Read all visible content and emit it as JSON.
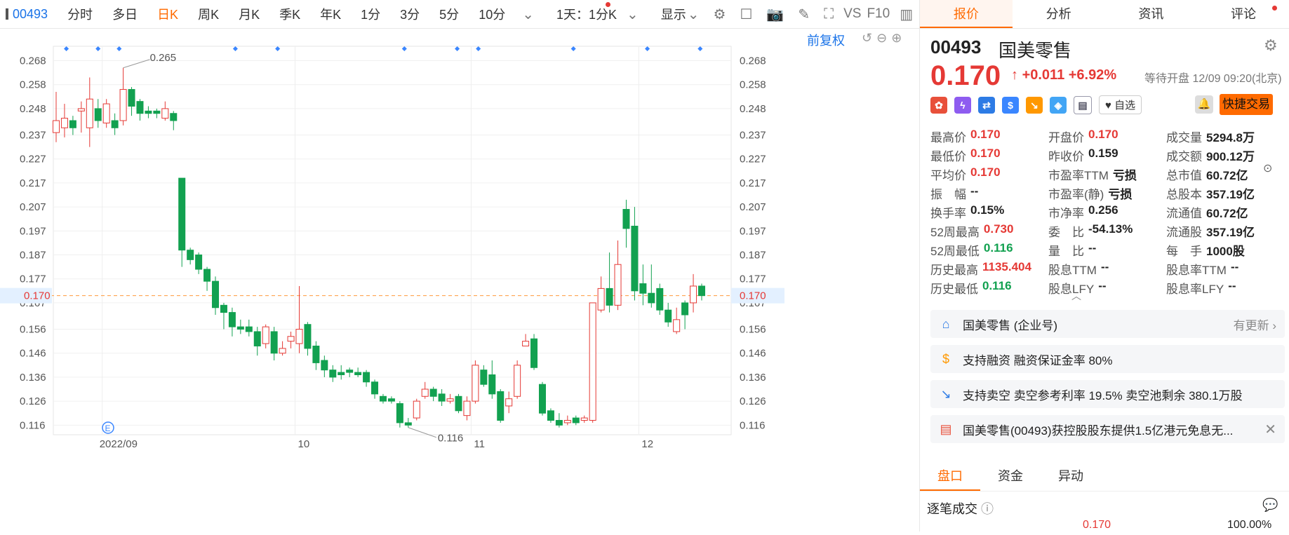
{
  "toolbar": {
    "code": "00493",
    "items": [
      "分时",
      "多日",
      "日K",
      "周K",
      "月K",
      "季K",
      "年K",
      "1分",
      "3分",
      "5分",
      "10分"
    ],
    "active": "日K",
    "period_select": "1天：1分K",
    "display": "显示",
    "vs": "VS",
    "f10": "F10"
  },
  "chart": {
    "fuquan_label": "前复权",
    "y_ticks": [
      "0.268",
      "0.258",
      "0.248",
      "0.237",
      "0.227",
      "0.217",
      "0.207",
      "0.197",
      "0.187",
      "0.177",
      "0.167",
      "0.156",
      "0.146",
      "0.136",
      "0.126",
      "0.116"
    ],
    "x_labels": [
      "2022/09",
      "10",
      "11",
      "12"
    ],
    "current_price_label": "0.170",
    "max_label": "0.265",
    "min_label": "0.116",
    "event_marker": "E"
  },
  "chart_data": {
    "type": "candlestick",
    "ylim": [
      0.112,
      0.274
    ],
    "current": 0.17,
    "candles": [
      [
        0.238,
        0.243,
        0.255,
        0.234
      ],
      [
        0.24,
        0.244,
        0.25,
        0.236
      ],
      [
        0.243,
        0.24,
        0.245,
        0.237
      ],
      [
        0.247,
        0.248,
        0.251,
        0.238
      ],
      [
        0.24,
        0.252,
        0.261,
        0.232
      ],
      [
        0.248,
        0.243,
        0.252,
        0.24
      ],
      [
        0.242,
        0.25,
        0.252,
        0.24
      ],
      [
        0.243,
        0.24,
        0.246,
        0.237
      ],
      [
        0.243,
        0.256,
        0.265,
        0.241
      ],
      [
        0.256,
        0.249,
        0.257,
        0.245
      ],
      [
        0.251,
        0.246,
        0.252,
        0.243
      ],
      [
        0.247,
        0.246,
        0.249,
        0.244
      ],
      [
        0.247,
        0.246,
        0.248,
        0.244
      ],
      [
        0.244,
        0.248,
        0.251,
        0.243
      ],
      [
        0.246,
        0.243,
        0.247,
        0.239
      ],
      [
        0.219,
        0.189,
        0.219,
        0.182
      ],
      [
        0.189,
        0.185,
        0.19,
        0.183
      ],
      [
        0.187,
        0.181,
        0.188,
        0.179
      ],
      [
        0.181,
        0.176,
        0.182,
        0.172
      ],
      [
        0.176,
        0.165,
        0.178,
        0.162
      ],
      [
        0.166,
        0.163,
        0.167,
        0.156
      ],
      [
        0.163,
        0.157,
        0.165,
        0.153
      ],
      [
        0.157,
        0.156,
        0.16,
        0.154
      ],
      [
        0.157,
        0.155,
        0.16,
        0.153
      ],
      [
        0.155,
        0.149,
        0.157,
        0.145
      ],
      [
        0.15,
        0.157,
        0.158,
        0.148
      ],
      [
        0.155,
        0.146,
        0.157,
        0.143
      ],
      [
        0.146,
        0.148,
        0.151,
        0.145
      ],
      [
        0.151,
        0.153,
        0.155,
        0.148
      ],
      [
        0.15,
        0.156,
        0.174,
        0.146
      ],
      [
        0.158,
        0.148,
        0.159,
        0.145
      ],
      [
        0.149,
        0.142,
        0.151,
        0.139
      ],
      [
        0.143,
        0.139,
        0.145,
        0.136
      ],
      [
        0.139,
        0.136,
        0.141,
        0.134
      ],
      [
        0.138,
        0.137,
        0.141,
        0.135
      ],
      [
        0.139,
        0.138,
        0.14,
        0.136
      ],
      [
        0.138,
        0.137,
        0.14,
        0.136
      ],
      [
        0.138,
        0.134,
        0.139,
        0.132
      ],
      [
        0.134,
        0.129,
        0.135,
        0.127
      ],
      [
        0.128,
        0.126,
        0.129,
        0.125
      ],
      [
        0.127,
        0.126,
        0.128,
        0.125
      ],
      [
        0.125,
        0.117,
        0.126,
        0.115
      ],
      [
        0.117,
        0.116,
        0.119,
        0.115
      ],
      [
        0.119,
        0.126,
        0.127,
        0.118
      ],
      [
        0.128,
        0.131,
        0.134,
        0.127
      ],
      [
        0.131,
        0.128,
        0.132,
        0.126
      ],
      [
        0.129,
        0.126,
        0.131,
        0.124
      ],
      [
        0.126,
        0.127,
        0.129,
        0.125
      ],
      [
        0.128,
        0.122,
        0.129,
        0.121
      ],
      [
        0.12,
        0.126,
        0.128,
        0.118
      ],
      [
        0.126,
        0.141,
        0.143,
        0.125
      ],
      [
        0.139,
        0.133,
        0.141,
        0.132
      ],
      [
        0.137,
        0.129,
        0.143,
        0.127
      ],
      [
        0.13,
        0.118,
        0.131,
        0.117
      ],
      [
        0.124,
        0.127,
        0.13,
        0.121
      ],
      [
        0.128,
        0.141,
        0.143,
        0.127
      ],
      [
        0.149,
        0.151,
        0.154,
        0.149
      ],
      [
        0.152,
        0.14,
        0.154,
        0.139
      ],
      [
        0.133,
        0.121,
        0.134,
        0.12
      ],
      [
        0.122,
        0.118,
        0.123,
        0.117
      ],
      [
        0.118,
        0.116,
        0.121,
        0.115
      ],
      [
        0.117,
        0.118,
        0.12,
        0.116
      ],
      [
        0.119,
        0.117,
        0.12,
        0.116
      ],
      [
        0.118,
        0.119,
        0.12,
        0.117
      ],
      [
        0.118,
        0.167,
        0.167,
        0.117
      ],
      [
        0.164,
        0.173,
        0.178,
        0.163
      ],
      [
        0.173,
        0.166,
        0.188,
        0.163
      ],
      [
        0.166,
        0.183,
        0.193,
        0.164
      ],
      [
        0.206,
        0.198,
        0.21,
        0.19
      ],
      [
        0.199,
        0.172,
        0.207,
        0.168
      ],
      [
        0.175,
        0.171,
        0.183,
        0.166
      ],
      [
        0.171,
        0.167,
        0.183,
        0.165
      ],
      [
        0.173,
        0.164,
        0.175,
        0.162
      ],
      [
        0.164,
        0.159,
        0.167,
        0.157
      ],
      [
        0.155,
        0.16,
        0.165,
        0.154
      ],
      [
        0.167,
        0.162,
        0.168,
        0.156
      ],
      [
        0.167,
        0.174,
        0.179,
        0.163
      ],
      [
        0.174,
        0.17,
        0.175,
        0.168
      ]
    ]
  },
  "panel": {
    "tabs": [
      "报价",
      "分析",
      "资讯",
      "评论"
    ],
    "active_tab": "报价",
    "code": "00493",
    "name": "国美零售",
    "price": "0.170",
    "change": "+0.011",
    "change_pct": "+6.92%",
    "status": "等待开盘 12/09 09:20(北京)",
    "fav": "自选",
    "quick_trade": "快捷交易",
    "stats": [
      [
        [
          "最高价",
          "0.170",
          "red"
        ],
        [
          "开盘价",
          "0.170",
          "red"
        ],
        [
          "成交量",
          "5294.8万",
          ""
        ]
      ],
      [
        [
          "最低价",
          "0.170",
          "red"
        ],
        [
          "昨收价",
          "0.159",
          ""
        ],
        [
          "成交额",
          "900.12万",
          ""
        ]
      ],
      [
        [
          "平均价",
          "0.170",
          "red"
        ],
        [
          "市盈率TTM",
          "亏损",
          ""
        ],
        [
          "总市值",
          "60.72亿",
          ""
        ]
      ],
      [
        [
          "振　幅",
          "--",
          ""
        ],
        [
          "市盈率(静)",
          "亏损",
          ""
        ],
        [
          "总股本",
          "357.19亿",
          ""
        ]
      ],
      [
        [
          "换手率",
          "0.15%",
          ""
        ],
        [
          "市净率",
          "0.256",
          ""
        ],
        [
          "流通值",
          "60.72亿",
          ""
        ]
      ],
      [
        [
          "52周最高",
          "0.730",
          "red"
        ],
        [
          "委　比",
          "-54.13%",
          ""
        ],
        [
          "流通股",
          "357.19亿",
          ""
        ]
      ],
      [
        [
          "52周最低",
          "0.116",
          "green"
        ],
        [
          "量　比",
          "--",
          ""
        ],
        [
          "每　手",
          "1000股",
          ""
        ]
      ],
      [
        [
          "历史最高",
          "1135.404",
          "red"
        ],
        [
          "股息TTM",
          "--",
          ""
        ],
        [
          "股息率TTM",
          "--",
          ""
        ]
      ],
      [
        [
          "历史最低",
          "0.116",
          "green"
        ],
        [
          "股息LFY",
          "--",
          ""
        ],
        [
          "股息率LFY",
          "--",
          ""
        ]
      ]
    ],
    "info": [
      {
        "text": "国美零售 (企业号)",
        "right": "有更新"
      },
      {
        "text": "支持融资 融资保证金率 80%",
        "right": ""
      },
      {
        "text": "支持卖空 卖空参考利率 19.5% 卖空池剩余 380.1万股",
        "right": ""
      },
      {
        "text": "国美零售(00493)获控股股东提供1.5亿港元免息无...",
        "right": ""
      }
    ],
    "bottom_tabs": [
      "盘口",
      "资金",
      "异动"
    ],
    "trades_title": "逐笔成交",
    "cut_left": "0.170",
    "cut_right": "100.00%"
  },
  "colors": {
    "up": "#e53935",
    "down": "#12a150",
    "accent": "#ff6a00",
    "link": "#1a73e8"
  }
}
